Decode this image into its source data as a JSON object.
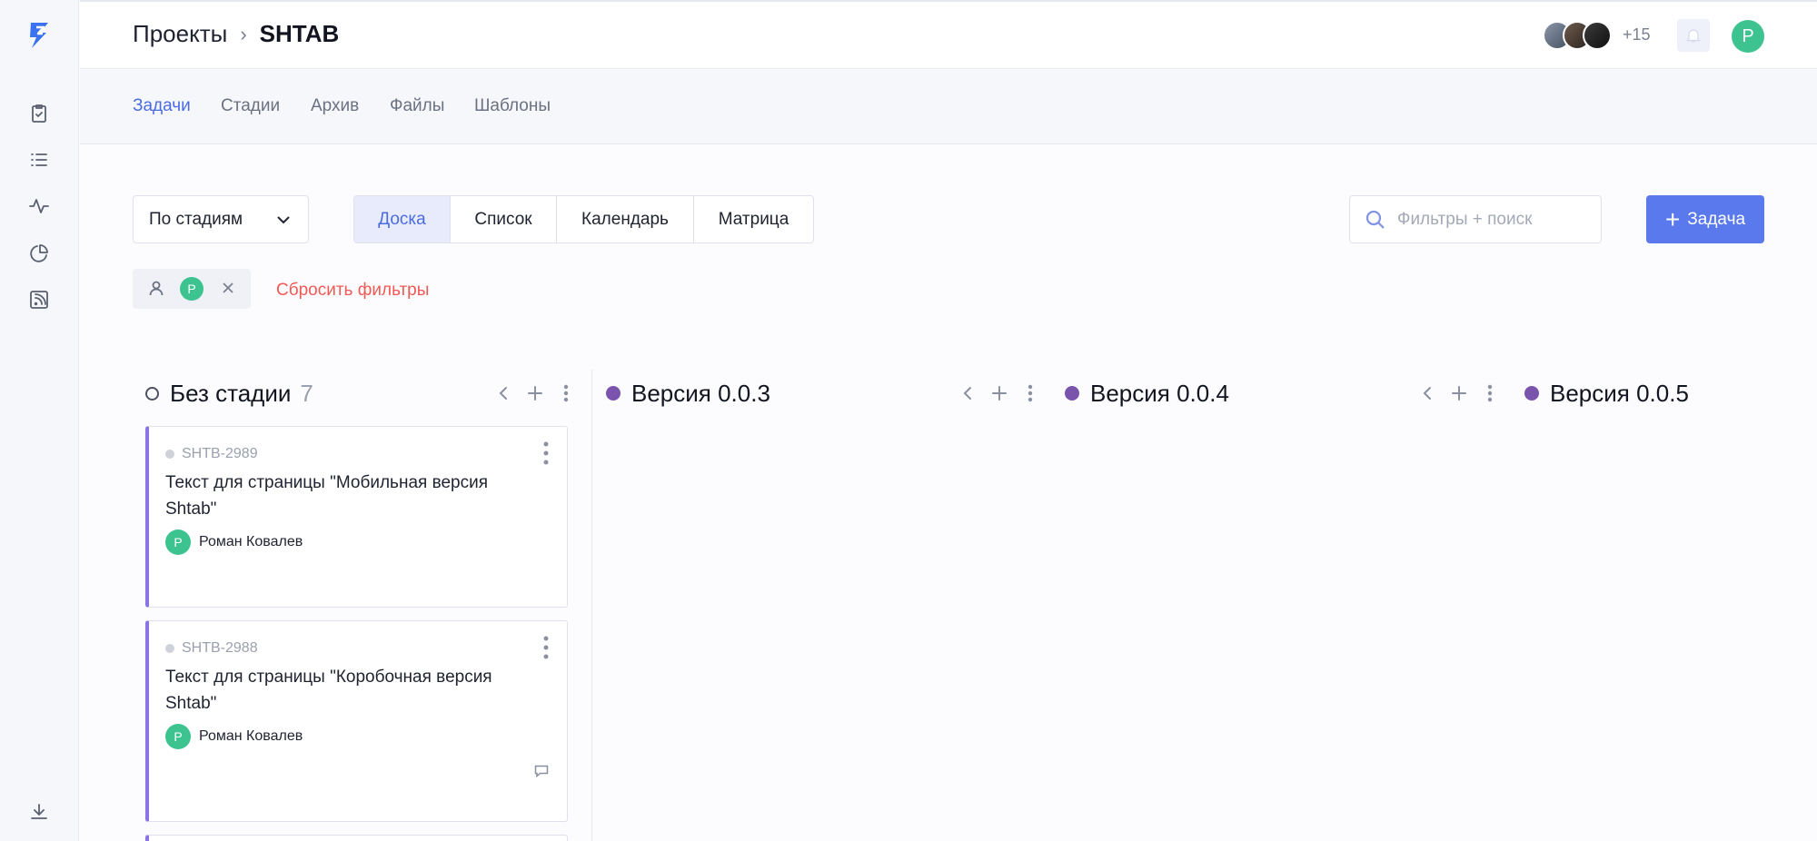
{
  "sidebar": {
    "logo": "shtab-logo",
    "items": [
      {
        "icon": "clipboard-check-icon"
      },
      {
        "icon": "list-icon"
      },
      {
        "icon": "activity-icon"
      },
      {
        "icon": "pie-chart-icon"
      },
      {
        "icon": "rss-icon"
      }
    ],
    "bottom_icon": "download-icon"
  },
  "header": {
    "breadcrumb_parent": "Проекты",
    "breadcrumb_current": "SHTAB",
    "members_more": "+15",
    "user_initial": "Р"
  },
  "tabs": [
    {
      "label": "Задачи",
      "active": true
    },
    {
      "label": "Стадии"
    },
    {
      "label": "Архив"
    },
    {
      "label": "Файлы"
    },
    {
      "label": "Шаблоны"
    }
  ],
  "toolbar": {
    "group_by": "По стадиям",
    "views": [
      {
        "label": "Доска",
        "active": true
      },
      {
        "label": "Список"
      },
      {
        "label": "Календарь"
      },
      {
        "label": "Матрица"
      }
    ],
    "search_placeholder": "Фильтры + поиск",
    "add_task_label": "Задача"
  },
  "filters": {
    "assignee_initial": "Р",
    "reset_label": "Сбросить фильтры"
  },
  "columns": [
    {
      "title": "Без стадии",
      "count": "7",
      "dot": "empty"
    },
    {
      "title": "Версия 0.0.3",
      "dot": "#7a53ad"
    },
    {
      "title": "Версия 0.0.4",
      "dot": "#7a53ad"
    },
    {
      "title": "Версия 0.0.5",
      "dot": "#7a53ad"
    }
  ],
  "cards": [
    {
      "id": "SHTB-2989",
      "title": "Текст для страницы \"Мобильная версия Shtab\"",
      "assignee": "Роман Ковалев",
      "assignee_initial": "Р",
      "has_comment": false
    },
    {
      "id": "SHTB-2988",
      "title": "Текст для страницы \"Коробочная версия Shtab\"",
      "assignee": "Роман Ковалев",
      "assignee_initial": "Р",
      "has_comment": true
    }
  ],
  "colors": {
    "accent": "#5a79ec",
    "active_tab": "#4a6ce0",
    "stage_purple": "#7a53ad",
    "avatar_green": "#3cc390",
    "danger": "#f05a55",
    "card_border": "#8a74e8"
  }
}
